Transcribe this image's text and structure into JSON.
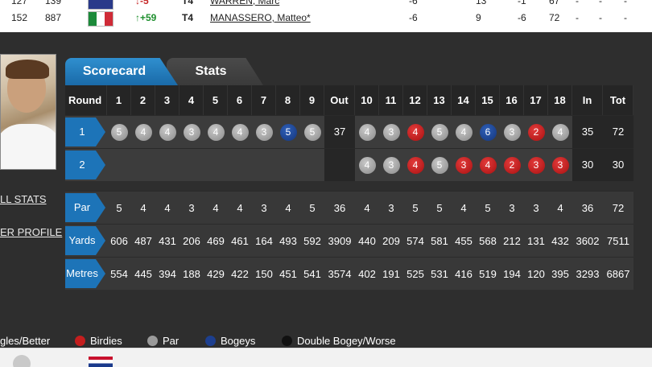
{
  "leaderboard": {
    "rows": [
      {
        "pos": "127",
        "prev": "139",
        "movement": "↓-5",
        "movement_dir": "down",
        "tie": "T4",
        "player": "WARREN, Marc",
        "c1": "-6",
        "c2": "13",
        "c3": "-1",
        "c4": "67",
        "c5": "-",
        "c6": "-",
        "c7": "-"
      },
      {
        "pos": "152",
        "prev": "887",
        "movement": "↑+59",
        "movement_dir": "up",
        "tie": "T4",
        "player": "MANASSERO, Matteo*",
        "c1": "-6",
        "c2": "9",
        "c3": "-6",
        "c4": "72",
        "c5": "-",
        "c6": "-",
        "c7": "-"
      }
    ]
  },
  "side_links": {
    "all_stats": "LL STATS",
    "player_profile": "ER PROFILE"
  },
  "tabs": {
    "scorecard": "Scorecard",
    "stats": "Stats"
  },
  "scorecard": {
    "header": [
      "Round",
      "1",
      "2",
      "3",
      "4",
      "5",
      "6",
      "7",
      "8",
      "9",
      "Out",
      "10",
      "11",
      "12",
      "13",
      "14",
      "15",
      "16",
      "17",
      "18",
      "In",
      "Tot"
    ],
    "rounds": [
      {
        "label": "1",
        "front": [
          {
            "v": "5",
            "t": "par"
          },
          {
            "v": "4",
            "t": "par"
          },
          {
            "v": "4",
            "t": "par"
          },
          {
            "v": "3",
            "t": "par"
          },
          {
            "v": "4",
            "t": "par"
          },
          {
            "v": "4",
            "t": "par"
          },
          {
            "v": "3",
            "t": "par"
          },
          {
            "v": "5",
            "t": "bogey"
          },
          {
            "v": "5",
            "t": "par"
          }
        ],
        "out": "37",
        "back": [
          {
            "v": "4",
            "t": "par"
          },
          {
            "v": "3",
            "t": "par"
          },
          {
            "v": "4",
            "t": "bird"
          },
          {
            "v": "5",
            "t": "par"
          },
          {
            "v": "4",
            "t": "par"
          },
          {
            "v": "6",
            "t": "bogey"
          },
          {
            "v": "3",
            "t": "par"
          },
          {
            "v": "2",
            "t": "bird"
          },
          {
            "v": "4",
            "t": "par"
          }
        ],
        "in": "35",
        "tot": "72"
      },
      {
        "label": "2",
        "front": [],
        "out": "",
        "back": [
          {
            "v": "4",
            "t": "par"
          },
          {
            "v": "3",
            "t": "par"
          },
          {
            "v": "4",
            "t": "bird"
          },
          {
            "v": "5",
            "t": "par"
          },
          {
            "v": "3",
            "t": "bird"
          },
          {
            "v": "4",
            "t": "bird"
          },
          {
            "v": "2",
            "t": "bird"
          },
          {
            "v": "3",
            "t": "bird"
          },
          {
            "v": "3",
            "t": "bird"
          }
        ],
        "in": "30",
        "tot": "30"
      }
    ],
    "par": {
      "label": "Par",
      "front": [
        "5",
        "4",
        "4",
        "3",
        "4",
        "4",
        "3",
        "4",
        "5"
      ],
      "out": "36",
      "back": [
        "4",
        "3",
        "5",
        "5",
        "4",
        "5",
        "3",
        "3",
        "4"
      ],
      "in": "36",
      "tot": "72"
    },
    "yards": {
      "label": "Yards",
      "front": [
        "606",
        "487",
        "431",
        "206",
        "469",
        "461",
        "164",
        "493",
        "592"
      ],
      "out": "3909",
      "back": [
        "440",
        "209",
        "574",
        "581",
        "455",
        "568",
        "212",
        "131",
        "432"
      ],
      "in": "3602",
      "tot": "7511"
    },
    "metres": {
      "label": "Metres",
      "front": [
        "554",
        "445",
        "394",
        "188",
        "429",
        "422",
        "150",
        "451",
        "541"
      ],
      "out": "3574",
      "back": [
        "402",
        "191",
        "525",
        "531",
        "416",
        "519",
        "194",
        "120",
        "395"
      ],
      "in": "3293",
      "tot": "6867"
    }
  },
  "legend": {
    "eagles": "gles/Better",
    "birdies": "Birdies",
    "par": "Par",
    "bogeys": "Bogeys",
    "double": "Double Bogey/Worse"
  },
  "colors": {
    "par_ball": "#9a9a9a",
    "birdie_ball": "#c41e1e",
    "bogey_ball": "#1d3f8f",
    "double_ball": "#111111",
    "tab_active": "#2a82c4"
  }
}
